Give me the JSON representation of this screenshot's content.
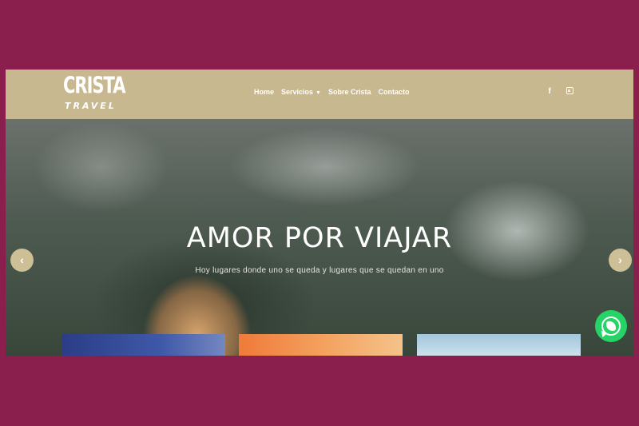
{
  "header": {
    "logo": {
      "line1": "CRISTA",
      "line2": "TRAVEL"
    },
    "nav": {
      "home": "Home",
      "services": "Servicios",
      "about": "Sobre Crista",
      "contact": "Contacto"
    },
    "social": {
      "facebook_icon": "f",
      "instagram_icon": "instagram-icon"
    }
  },
  "hero": {
    "title": "AMOR POR VIAJAR",
    "subtitle": "Hoy lugares donde uno se queda y lugares que se quedan en uno",
    "prev_arrow": "‹",
    "next_arrow": "›"
  },
  "colors": {
    "background": "#8a1f4e",
    "header": "#c8b88f",
    "arrow": "#cdbf96",
    "whatsapp": "#25d366"
  },
  "floating": {
    "whatsapp_icon": "whatsapp-icon"
  }
}
